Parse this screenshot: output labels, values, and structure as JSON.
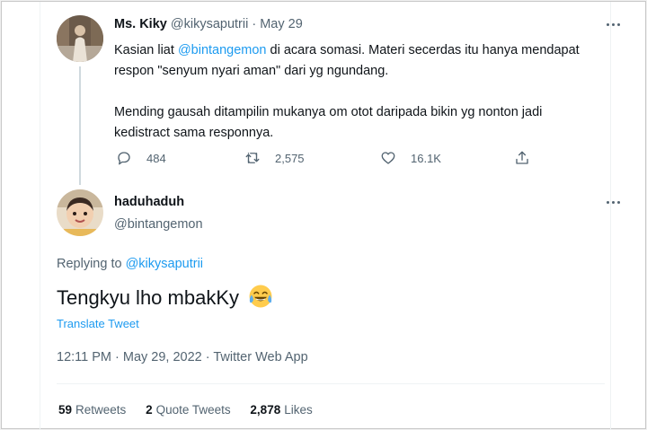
{
  "parent_tweet": {
    "display_name": "Ms. Kiky",
    "handle": "@kikysaputrii",
    "separator": "·",
    "date": "May 29",
    "body": {
      "p1_before": "Kasian liat ",
      "p1_mention": "@bintangemon",
      "p1_after": " di acara somasi. Materi secerdas itu hanya mendapat respon \"senyum nyari aman\" dari yg ngundang.",
      "p2": "Mending gausah ditampilin mukanya om otot daripada bikin yg nonton jadi kedistract sama responnya."
    },
    "actions": {
      "replies": "484",
      "retweets": "2,575",
      "likes": "16.1K"
    }
  },
  "main_tweet": {
    "display_name": "haduhaduh",
    "handle": "@bintangemon",
    "replying_label": "Replying to ",
    "replying_handle": "@kikysaputrii",
    "text": "Tengkyu lho mbakKy",
    "emoji": "face-with-tears-of-joy",
    "translate_label": "Translate Tweet",
    "meta": "12:11 PM · May 29, 2022 · Twitter Web App",
    "stats": {
      "retweets_count": "59",
      "retweets_label": "Retweets",
      "quotes_count": "2",
      "quotes_label": "Quote Tweets",
      "likes_count": "2,878",
      "likes_label": "Likes"
    }
  },
  "colors": {
    "link": "#1d9bf0",
    "secondary_text": "#536471",
    "primary_text": "#0f1419"
  }
}
